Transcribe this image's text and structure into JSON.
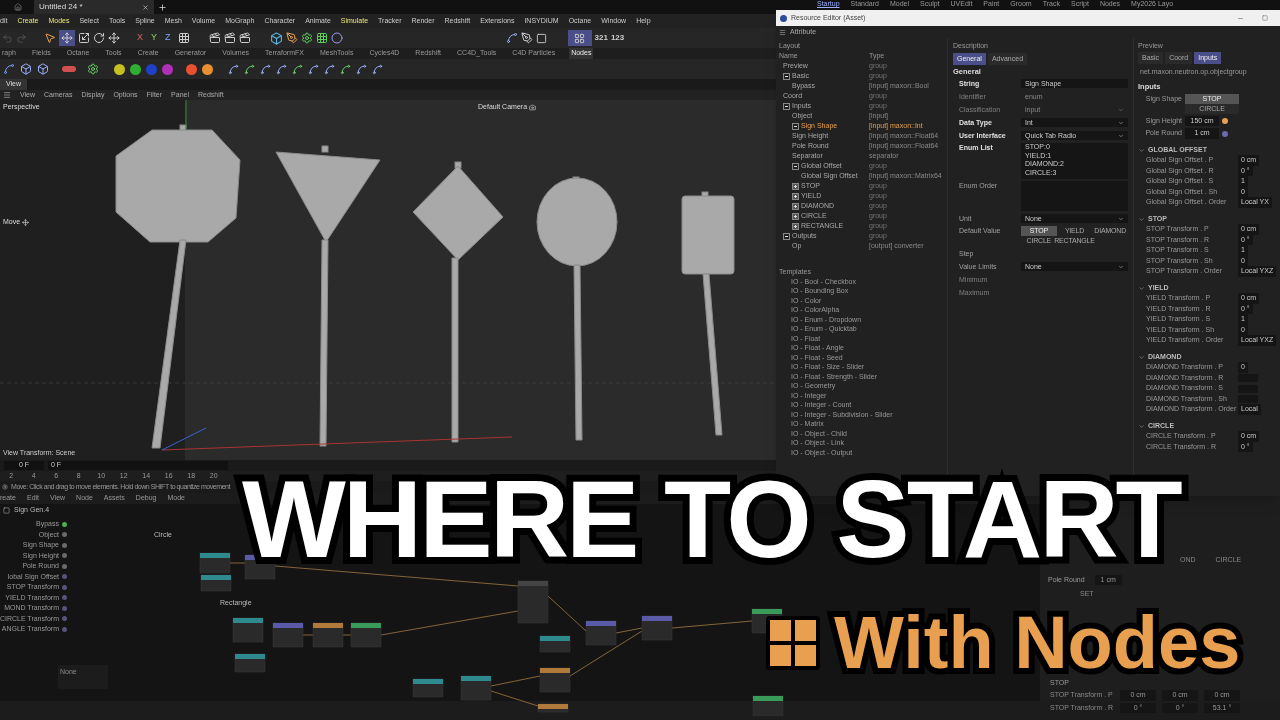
{
  "top_bar": {
    "document_tab": "Untitled 24 *",
    "layouts": [
      {
        "label": "Startup",
        "selected": true
      },
      {
        "label": "Standard",
        "selected": false
      },
      {
        "label": "Model",
        "selected": false
      },
      {
        "label": "Sculpt",
        "selected": false
      },
      {
        "label": "UVEdit",
        "selected": false
      },
      {
        "label": "Paint",
        "selected": false
      },
      {
        "label": "Groom",
        "selected": false
      },
      {
        "label": "Track",
        "selected": false
      },
      {
        "label": "Script",
        "selected": false
      },
      {
        "label": "Nodes",
        "selected": false
      },
      {
        "label": "My2026 Layo",
        "selected": false
      }
    ]
  },
  "menu": [
    {
      "label": "dit",
      "highlight": false
    },
    {
      "label": "Create",
      "highlight": true
    },
    {
      "label": "Modes",
      "highlight": true
    },
    {
      "label": "Select",
      "highlight": false
    },
    {
      "label": "Tools",
      "highlight": false
    },
    {
      "label": "Spline",
      "highlight": false
    },
    {
      "label": "Mesh",
      "highlight": false
    },
    {
      "label": "Volume",
      "highlight": false
    },
    {
      "label": "MoGraph",
      "highlight": false
    },
    {
      "label": "Character",
      "highlight": false
    },
    {
      "label": "Animate",
      "highlight": false
    },
    {
      "label": "Simulate",
      "highlight": true
    },
    {
      "label": "Tracker",
      "highlight": false
    },
    {
      "label": "Render",
      "highlight": false
    },
    {
      "label": "Redshift",
      "highlight": false
    },
    {
      "label": "Extensions",
      "highlight": false
    },
    {
      "label": "INSYDIUM",
      "highlight": false
    },
    {
      "label": "Octane",
      "highlight": false
    },
    {
      "label": "Window",
      "highlight": false
    },
    {
      "label": "Help",
      "highlight": false
    }
  ],
  "toolbar": {
    "axes": [
      "X",
      "Y",
      "Z"
    ],
    "order_buttons": [
      "321",
      "123"
    ]
  },
  "palette_tabs": [
    {
      "label": "raph",
      "selected": false
    },
    {
      "label": "Fields",
      "selected": false
    },
    {
      "label": "Octane",
      "selected": false
    },
    {
      "label": "Tools",
      "selected": false
    },
    {
      "label": "Create",
      "selected": false
    },
    {
      "label": "Generator",
      "selected": false
    },
    {
      "label": "Volumes",
      "selected": false
    },
    {
      "label": "TerraformFX",
      "selected": false
    },
    {
      "label": "MeshTools",
      "selected": false
    },
    {
      "label": "Cycles4D",
      "selected": false
    },
    {
      "label": "Redshift",
      "selected": false
    },
    {
      "label": "CC4D_Tools",
      "selected": false
    },
    {
      "label": "C4D Particles",
      "selected": false
    },
    {
      "label": "Nodes",
      "selected": true
    }
  ],
  "viewport": {
    "tab": "View",
    "menu": [
      "View",
      "Cameras",
      "Display",
      "Options",
      "Filter",
      "Panel",
      "Redshift"
    ],
    "projection": "Perspective",
    "camera": "Default Camera",
    "tool": "Move",
    "view_transform": "View Transform: Scene"
  },
  "timeline": {
    "fields": [
      "0 F",
      "0 F"
    ],
    "ticks": [
      "2",
      "4",
      "6",
      "8",
      "10",
      "12",
      "14",
      "16",
      "18",
      "20"
    ]
  },
  "status": "Move: Click and drag to move elements. Hold down SHIFT to quantize movement",
  "node_editor": {
    "menu": [
      "reate",
      "Edit",
      "View",
      "Node",
      "Assets",
      "Debug",
      "Mode"
    ],
    "asset": "Sign Gen.4",
    "ports": [
      {
        "label": "Bypass",
        "color": "#4caf50"
      },
      {
        "label": "Object",
        "color": "#6a6a6a"
      },
      {
        "label": "Sign Shape",
        "color": "#6a6a6a"
      },
      {
        "label": "Sign Height",
        "color": "#6a6a6a"
      },
      {
        "label": "Pole Round",
        "color": "#6a6a6a"
      },
      {
        "label": "lobal Sign Offset",
        "color": "#55557a"
      },
      {
        "label": "STOP Transform",
        "color": "#55557a"
      },
      {
        "label": "YIELD Transform",
        "color": "#55557a"
      },
      {
        "label": "MOND Transform",
        "color": "#55557a"
      },
      {
        "label": "CIRCLE Transform",
        "color": "#55557a"
      },
      {
        "label": "ANGLE Transform",
        "color": "#55557a"
      }
    ],
    "groups": [
      "Circle",
      "Rectangle"
    ],
    "search_placeholder": "None"
  },
  "attributes": {
    "tabs": [
      {
        "label": "OND",
        "selected": false
      },
      {
        "label": "CIRCLE",
        "selected": false
      }
    ],
    "pole_round": {
      "label": "Pole Round",
      "value": "1 cm"
    },
    "offset_heading": "SET",
    "section": "STOP",
    "rows": [
      {
        "label": "STOP Transform . P",
        "values": [
          "0 cm",
          "0 cm",
          "0 cm"
        ]
      },
      {
        "label": "STOP Transform . R",
        "values": [
          "0 °",
          "0 °",
          "53.1 °"
        ]
      }
    ]
  },
  "resource_editor": {
    "title": "Resource Editor (Asset)",
    "menu": "Attribute",
    "layout": {
      "heading": "Layout",
      "columns": [
        "Name",
        "Type"
      ],
      "tree": [
        {
          "name": "Preview",
          "type": "group",
          "selected": false
        },
        {
          "name": "Basic",
          "type": "group",
          "selected": false,
          "expanded": true,
          "children": [
            {
              "name": "Bypass",
              "type": "[input] maxon::Bool",
              "selected": false
            }
          ]
        },
        {
          "name": "Coord",
          "type": "group",
          "selected": false
        },
        {
          "name": "Inputs",
          "type": "group",
          "selected": false,
          "expanded": true,
          "children": [
            {
              "name": "Object",
              "type": "[input]",
              "selected": false
            },
            {
              "name": "Sign Shape",
              "type": "[input] maxon::Int",
              "selected": true,
              "expanded": true
            },
            {
              "name": "Sign Height",
              "type": "[input] maxon::Float64",
              "selected": false
            },
            {
              "name": "Pole Round",
              "type": "[input] maxon::Float64",
              "selected": false
            },
            {
              "name": "Separator",
              "type": "separator",
              "selected": false
            },
            {
              "name": "Global Offset",
              "type": "group",
              "selected": false,
              "expanded": true,
              "children": [
                {
                  "name": "Global Sign Offset",
                  "type": "[input] maxon::Matrix64",
                  "selected": false
                }
              ]
            },
            {
              "name": "STOP",
              "type": "group",
              "selected": false,
              "expanded": false
            },
            {
              "name": "YIELD",
              "type": "group",
              "selected": false,
              "expanded": false
            },
            {
              "name": "DIAMOND",
              "type": "group",
              "selected": false,
              "expanded": false
            },
            {
              "name": "CIRCLE",
              "type": "group",
              "selected": false,
              "expanded": false
            },
            {
              "name": "RECTANGLE",
              "type": "group",
              "selected": false,
              "expanded": false
            }
          ]
        },
        {
          "name": "Outputs",
          "type": "group",
          "selected": false,
          "expanded": true,
          "children": [
            {
              "name": "Op",
              "type": "[output] converter",
              "selected": false
            }
          ]
        }
      ]
    },
    "templates": {
      "heading": "Templates",
      "items": [
        "IO - Bool - Checkbox",
        "IO - Bounding Box",
        "IO - Color",
        "IO - ColorAlpha",
        "IO - Enum - Dropdown",
        "IO - Enum - Quicktab",
        "IO - Float",
        "IO - Float - Angle",
        "IO - Float - Seed",
        "IO - Float - Size - Slider",
        "IO - Float - Strength - Slider",
        "IO - Geometry",
        "IO - Integer",
        "IO - Integer - Count",
        "IO - Integer - Subdivision - Slider",
        "IO - Matrix",
        "IO - Object - Child",
        "IO - Object - Link",
        "IO - Object - Output"
      ]
    },
    "description": {
      "heading": "Description",
      "tabs": [
        {
          "label": "General",
          "selected": true
        },
        {
          "label": "Advanced",
          "selected": false
        }
      ],
      "section": "General",
      "fields": [
        {
          "kind": "text",
          "label": "String",
          "value": "Sign Shape",
          "disabled": false,
          "emphasized": true
        },
        {
          "kind": "text",
          "label": "Identifier",
          "value": "enum",
          "disabled": true,
          "emphasized": false
        },
        {
          "kind": "dropdown",
          "label": "Classification",
          "value": "input",
          "disabled": true,
          "emphasized": false
        },
        {
          "kind": "dropdown",
          "label": "Data Type",
          "value": "Int",
          "disabled": false,
          "emphasized": true
        },
        {
          "kind": "dropdown",
          "label": "User Interface",
          "value": "Quick Tab Radio",
          "disabled": false,
          "emphasized": true
        },
        {
          "kind": "list",
          "label": "Enum List",
          "lines": [
            "STOP:0",
            "YIELD:1",
            "DIAMOND:2",
            "CIRCLE:3"
          ],
          "disabled": false,
          "emphasized": true
        },
        {
          "kind": "area",
          "label": "Enum Order",
          "disabled": false,
          "emphasized": false
        },
        {
          "kind": "dropdown",
          "label": "Unit",
          "value": "None",
          "disabled": false,
          "emphasized": false
        },
        {
          "kind": "quicktab",
          "label": "Default Value",
          "options": [
            {
              "label": "STOP",
              "selected": true
            },
            {
              "label": "YIELD",
              "selected": false
            },
            {
              "label": "DIAMOND",
              "selected": false
            },
            {
              "label": "CIRCLE",
              "selected": false
            },
            {
              "label": "RECTANGLE",
              "selected": false
            }
          ],
          "disabled": false,
          "emphasized": false
        },
        {
          "kind": "plain",
          "label": "Step",
          "disabled": false,
          "emphasized": false
        },
        {
          "kind": "dropdown",
          "label": "Value Limits",
          "value": "None",
          "disabled": false,
          "emphasized": false
        },
        {
          "kind": "plain",
          "label": "Minimum",
          "disabled": true,
          "emphasized": false
        },
        {
          "kind": "plain",
          "label": "Maximum",
          "disabled": true,
          "emphasized": false
        }
      ]
    },
    "preview": {
      "heading": "Preview",
      "tabs": [
        {
          "label": "Basic",
          "selected": false
        },
        {
          "label": "Coord",
          "selected": false
        },
        {
          "label": "Inputs",
          "selected": true
        }
      ],
      "asset_id": "net.maxon.neutron.op.objectgroup",
      "section": "Inputs",
      "sign_shape": {
        "label": "Sign Shape",
        "options": [
          {
            "label": "STOP",
            "selected": true
          },
          {
            "label": "CIRCLE",
            "selected": false
          }
        ]
      },
      "numbers": [
        {
          "label": "Sign Height",
          "value": "150 cm",
          "color": "#e8a050"
        },
        {
          "label": "Pole Round",
          "value": "1 cm",
          "color": "#6a6ab0"
        }
      ],
      "groups": [
        {
          "title": "GLOBAL OFFSET",
          "expanded": true,
          "rows": [
            {
              "label": "Global Sign Offset . P",
              "value": "0 cm"
            },
            {
              "label": "Global Sign Offset . R",
              "value": "0 °"
            },
            {
              "label": "Global Sign Offset . S",
              "value": "1"
            },
            {
              "label": "Global Sign Offset . Sh",
              "value": "0"
            },
            {
              "label": "Global Sign Offset . Order",
              "value": "Local YX"
            }
          ]
        },
        {
          "title": "STOP",
          "expanded": true,
          "rows": [
            {
              "label": "STOP Transform . P",
              "value": "0 cm"
            },
            {
              "label": "STOP Transform . R",
              "value": "0 °"
            },
            {
              "label": "STOP Transform . S",
              "value": "1"
            },
            {
              "label": "STOP Transform . Sh",
              "value": "0"
            },
            {
              "label": "STOP Transform . Order",
              "value": "Local YXZ"
            }
          ]
        },
        {
          "title": "YIELD",
          "expanded": true,
          "rows": [
            {
              "label": "YIELD Transform . P",
              "value": "0 cm"
            },
            {
              "label": "YIELD Transform . R",
              "value": "0 °"
            },
            {
              "label": "YIELD Transform . S",
              "value": "1"
            },
            {
              "label": "YIELD Transform . Sh",
              "value": "0"
            },
            {
              "label": "YIELD Transform . Order",
              "value": "Local YXZ"
            }
          ]
        },
        {
          "title": "DIAMOND",
          "expanded": true,
          "rows": [
            {
              "label": "DIAMOND Transform . P",
              "value": "0"
            },
            {
              "label": "DIAMOND Transform . R"
            },
            {
              "label": "DIAMOND Transform . S"
            },
            {
              "label": "DIAMOND Transform . Sh"
            },
            {
              "label": "DIAMOND Transform . Order",
              "value": "Local"
            }
          ]
        },
        {
          "title": "CIRCLE",
          "expanded": true,
          "rows": [
            {
              "label": "CIRCLE Transform . P",
              "value": "0 cm"
            },
            {
              "label": "CIRCLE Transform . R",
              "value": "0 °"
            }
          ]
        }
      ]
    }
  },
  "overlay": {
    "headline": "WHERE TO START",
    "subtitle": "With Nodes"
  }
}
